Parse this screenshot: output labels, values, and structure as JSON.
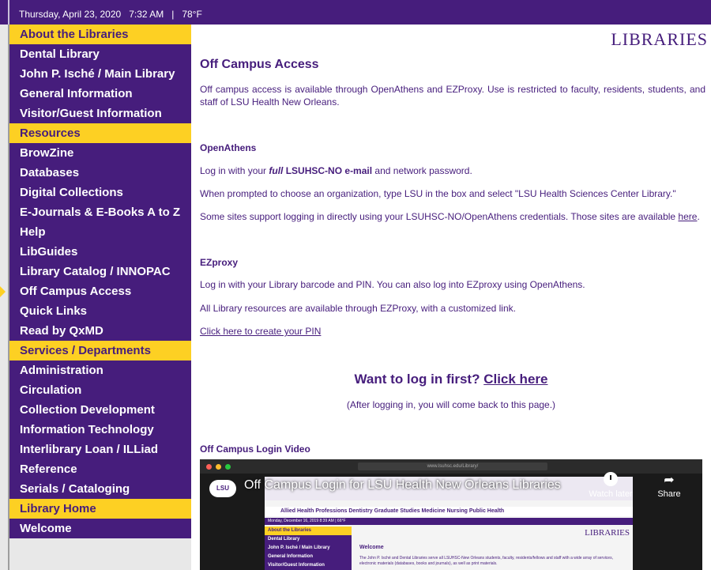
{
  "topbar": {
    "date": "Thursday, April 23, 2020   7:32 AM   |   78°F"
  },
  "sidebar": {
    "items": [
      {
        "label": "About the Libraries",
        "head": true
      },
      {
        "label": "Dental Library",
        "head": false
      },
      {
        "label": "John P. Isché / Main Library",
        "head": false
      },
      {
        "label": "General Information",
        "head": false
      },
      {
        "label": "Visitor/Guest Information",
        "head": false
      },
      {
        "label": "Resources",
        "head": true
      },
      {
        "label": "BrowZine",
        "head": false
      },
      {
        "label": "Databases",
        "head": false
      },
      {
        "label": "Digital Collections",
        "head": false
      },
      {
        "label": "E-Journals & E-Books A to Z",
        "head": false
      },
      {
        "label": "Help",
        "head": false
      },
      {
        "label": "LibGuides",
        "head": false
      },
      {
        "label": "Library Catalog / INNOPAC",
        "head": false
      },
      {
        "label": "Off Campus Access",
        "head": false
      },
      {
        "label": "Quick Links",
        "head": false
      },
      {
        "label": "Read by QxMD",
        "head": false
      },
      {
        "label": "Services / Departments",
        "head": true
      },
      {
        "label": "Administration",
        "head": false
      },
      {
        "label": "Circulation",
        "head": false
      },
      {
        "label": "Collection Development",
        "head": false
      },
      {
        "label": "Information Technology",
        "head": false
      },
      {
        "label": "Interlibrary Loan / ILLiad",
        "head": false
      },
      {
        "label": "Reference",
        "head": false
      },
      {
        "label": "Serials / Cataloging",
        "head": false
      },
      {
        "label": "Library Home",
        "head": true
      },
      {
        "label": "Welcome",
        "head": false
      }
    ]
  },
  "main": {
    "logo": "LIBRARIES",
    "title": "Off Campus Access",
    "intro": "Off campus access is available through OpenAthens and EZProxy. Use is restricted to faculty, residents, students, and staff of LSU Health New Orleans.",
    "openathens": {
      "heading": "OpenAthens",
      "line1_pre": "Log in with your ",
      "line1_em": "full",
      "line1_bold": " LSUHSC-NO e-mail",
      "line1_post": " and network password.",
      "line2": "When prompted to choose an organization, type LSU in the box and select \"LSU Health Sciences Center Library.\"",
      "line3_pre": "Some sites support logging in directly using your LSUHSC-NO/OpenAthens credentials. Those sites are available ",
      "line3_link": "here",
      "line3_post": "."
    },
    "ezproxy": {
      "heading": "EZproxy",
      "line1": "Log in with your Library barcode and PIN. You can also log into EZproxy using OpenAthens.",
      "line2": "All Library resources are available through EZProxy, with a customized link.",
      "pin_link": "Click here to create your PIN"
    },
    "cta": {
      "text": "Want to log in first? ",
      "link": "Click here",
      "sub": "(After logging in, you will come back to this page.)"
    },
    "video": {
      "heading": "Off Campus Login Video",
      "title": "Off Campus Login for LSU Health New Orleans Libraries",
      "watch_later": "Watch later",
      "share": "Share",
      "badge": "LSU",
      "url": "www.lsuhsc.edu/Library/",
      "thumb_menu": "Allied Health Professions    Dentistry    Graduate Studies    Medicine    Nursing    Public Health",
      "thumb_date": "Monday, December 16, 2019  8:39 AM  |  66°F",
      "thumb_logo": "LIBRARIES",
      "thumb_welcome": "Welcome",
      "thumb_text": "The John P. Isché and Dental Libraries serve all LSUHSC-New Orleans students, faculty, residents/fellows and staff with a wide array of services, electronic materials (databases, books and journals), as well as print materials.",
      "thumb_items": [
        "About the Libraries",
        "Dental Library",
        "John P. Isché / Main Library",
        "General Information",
        "Visitor/Guest Information"
      ]
    }
  },
  "colors": {
    "purple": "#461d7c",
    "gold": "#fdd023"
  }
}
